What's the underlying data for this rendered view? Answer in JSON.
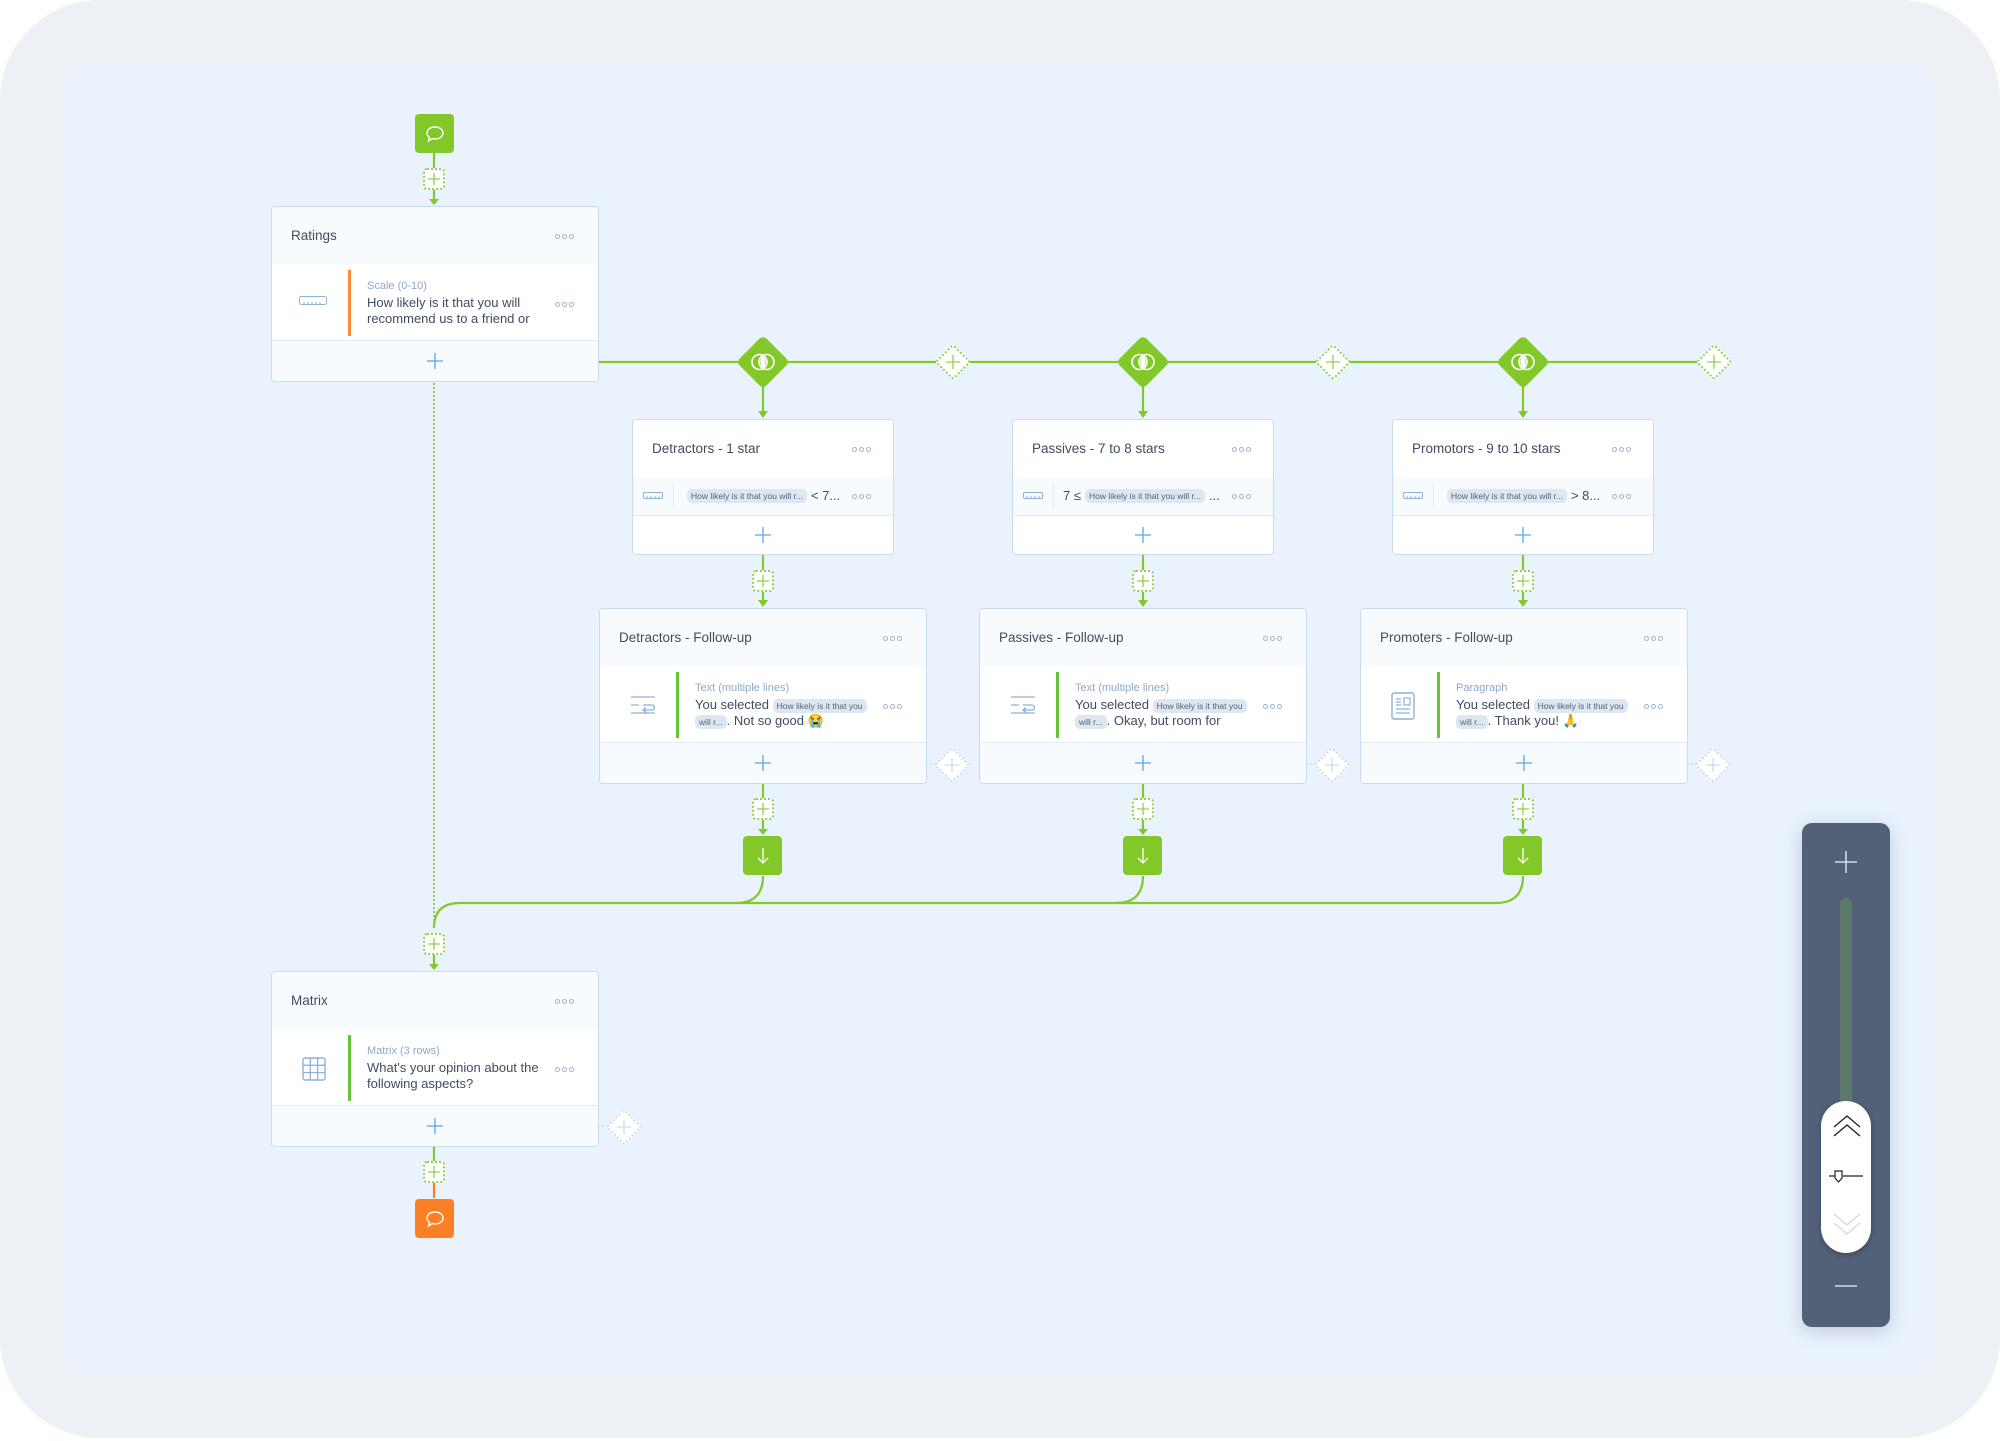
{
  "canvas": {
    "colors": {
      "accent_green": "#82c828",
      "end_orange": "#fd7f23",
      "add_blue": "#5aa7e8",
      "zoom_panel": "#526178"
    }
  },
  "start_node": {
    "icon": "speech-bubble-icon",
    "role": "start"
  },
  "end_node": {
    "icon": "speech-bubble-icon",
    "role": "end"
  },
  "blocks": [
    {
      "id": "ratings",
      "title": "Ratings",
      "question": {
        "icon": "scale-ruler-icon",
        "type": "Scale (0-10)",
        "text_line1": "How likely is it that you will",
        "text_line2": "recommend us to a friend or",
        "bar_color": "#fd8a3a"
      }
    },
    {
      "id": "matrix",
      "title": "Matrix",
      "question": {
        "icon": "grid-table-icon",
        "type": "Matrix (3 rows)",
        "text_line1": "What's your opinion about the",
        "text_line2": "following aspects?",
        "bar_color": "#69c33a"
      }
    }
  ],
  "branches": [
    {
      "condition": {
        "title": "Detractors - 1 star",
        "prefix": "",
        "chip": "How likely is it that you will r...",
        "suffix": "< 7..."
      },
      "followup": {
        "title": "Detractors - Follow-up",
        "icon": "multiline-text-icon",
        "type": "Text (multiple lines)",
        "text_prefix": "You selected",
        "chip_a": "How likely is it that you",
        "chip_b": "will r...",
        "text_suffix": ". Not so good 😭"
      }
    },
    {
      "condition": {
        "title": "Passives - 7 to 8 stars",
        "prefix": "7 ≤",
        "chip": "How likely is it that you will r...",
        "suffix": "..."
      },
      "followup": {
        "title": "Passives - Follow-up",
        "icon": "multiline-text-icon",
        "type": "Text (multiple lines)",
        "text_prefix": "You selected",
        "chip_a": "How likely is it that you",
        "chip_b": "will r...",
        "text_suffix": ". Okay, but room for"
      }
    },
    {
      "condition": {
        "title": "Promotors - 9 to 10 stars",
        "prefix": "",
        "chip": "How likely is it that you will r...",
        "suffix": "> 8..."
      },
      "followup": {
        "title": "Promoters - Follow-up",
        "icon": "paragraph-doc-icon",
        "type": "Paragraph",
        "text_prefix": "You selected",
        "chip_a": "How likely is it that you",
        "chip_b": "will r...",
        "text_suffix": ". Thank you! 🙏"
      }
    }
  ],
  "zoom_control": {
    "zoom_in_label": "+",
    "zoom_out_label": "−",
    "level_fraction": 0.25
  }
}
